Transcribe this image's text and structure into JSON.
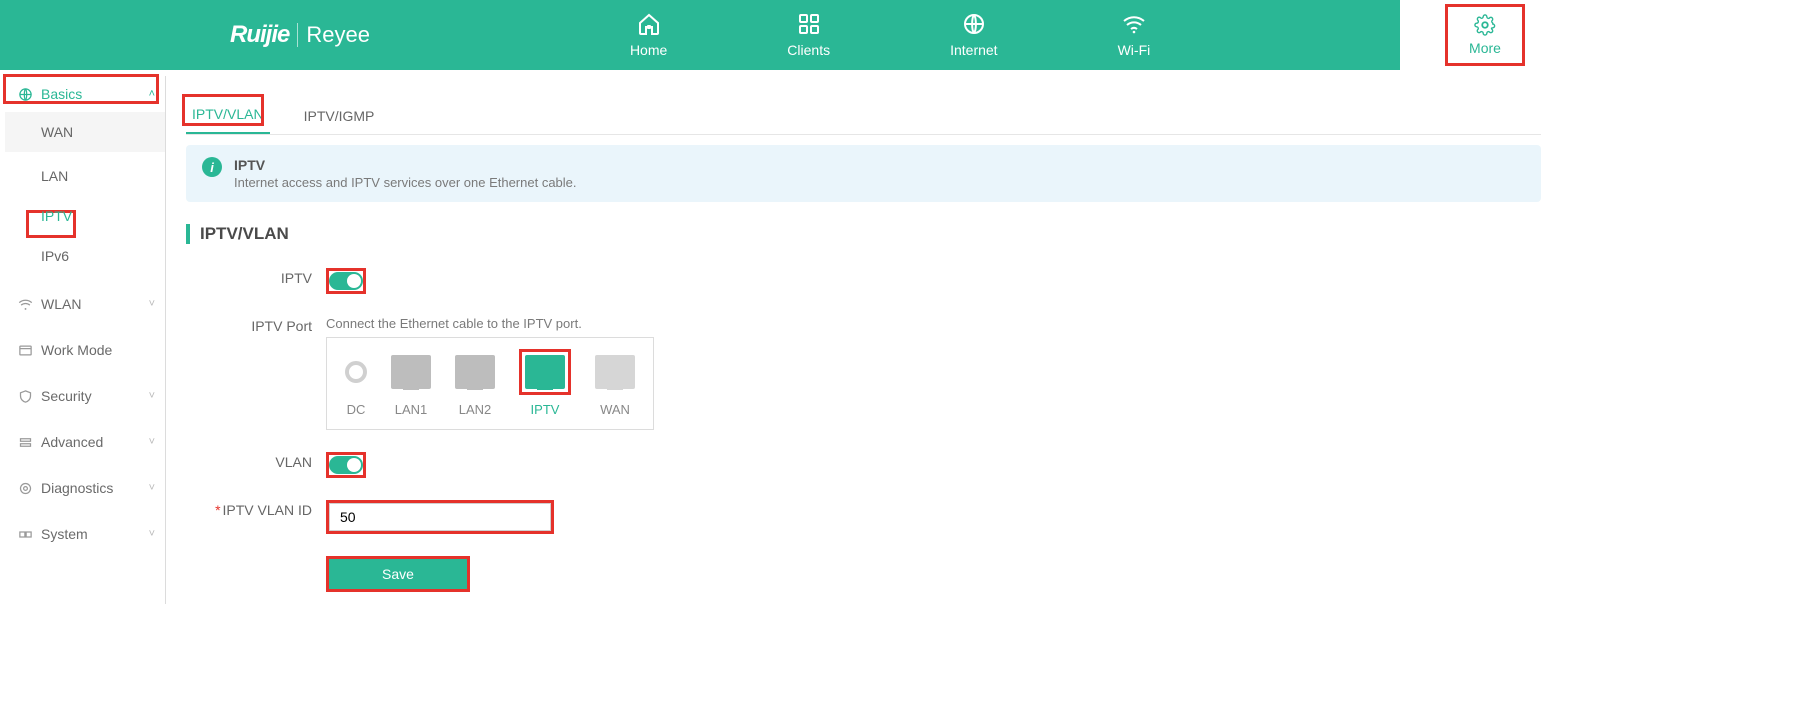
{
  "brand": {
    "primary": "Ruijie",
    "secondary": "Reyee"
  },
  "nav": {
    "home": "Home",
    "clients": "Clients",
    "internet": "Internet",
    "wifi": "Wi-Fi",
    "more": "More"
  },
  "sidebar": {
    "basics": {
      "label": "Basics",
      "items": {
        "wan": "WAN",
        "lan": "LAN",
        "iptv": "IPTV",
        "ipv6": "IPv6"
      }
    },
    "wlan": "WLAN",
    "work_mode": "Work Mode",
    "security": "Security",
    "advanced": "Advanced",
    "diagnostics": "Diagnostics",
    "system": "System"
  },
  "tabs": {
    "iptv_vlan": "IPTV/VLAN",
    "iptv_igmp": "IPTV/IGMP"
  },
  "banner": {
    "title": "IPTV",
    "desc": "Internet access and IPTV services over one Ethernet cable."
  },
  "section_title": "IPTV/VLAN",
  "form": {
    "iptv_label": "IPTV",
    "iptv_on": true,
    "port_label": "IPTV Port",
    "port_desc": "Connect the Ethernet cable to the IPTV port.",
    "ports": {
      "dc": "DC",
      "lan1": "LAN1",
      "lan2": "LAN2",
      "iptv": "IPTV",
      "wan": "WAN"
    },
    "vlan_label": "VLAN",
    "vlan_on": true,
    "vlan_id_label": "IPTV VLAN ID",
    "vlan_id_value": "50",
    "save": "Save"
  }
}
